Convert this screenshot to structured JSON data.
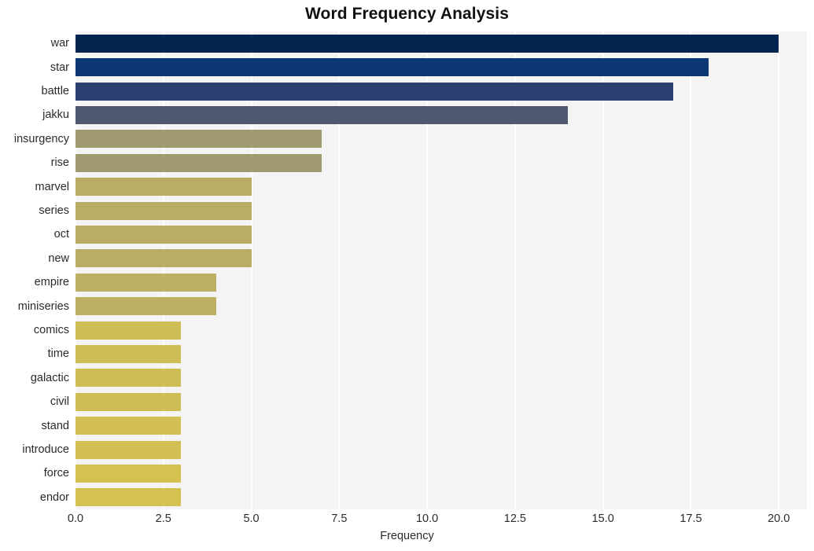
{
  "chart_data": {
    "type": "bar",
    "orientation": "horizontal",
    "title": "Word Frequency Analysis",
    "xlabel": "Frequency",
    "ylabel": "",
    "categories": [
      "war",
      "star",
      "battle",
      "jakku",
      "insurgency",
      "rise",
      "marvel",
      "series",
      "oct",
      "new",
      "empire",
      "miniseries",
      "comics",
      "time",
      "galactic",
      "civil",
      "stand",
      "introduce",
      "force",
      "endor"
    ],
    "values": [
      20,
      18,
      17,
      14,
      7,
      7,
      5,
      5,
      5,
      5,
      4,
      4,
      3,
      3,
      3,
      3,
      3,
      3,
      3,
      3
    ],
    "bar_colors": [
      "#03254f",
      "#0b3872",
      "#2a3f70",
      "#4f5871",
      "#a1996f",
      "#a1996f",
      "#b9ad66",
      "#b9ad66",
      "#b9ad66",
      "#b9ad66",
      "#bdb063",
      "#bdb063",
      "#cfbe55",
      "#cfbe55",
      "#cfbe55",
      "#cfbe55",
      "#d2c054",
      "#d2c054",
      "#d4c152",
      "#d4c152"
    ],
    "xlim": [
      0,
      20.8
    ],
    "xticks": [
      0,
      2.5,
      5,
      7.5,
      10,
      12.5,
      15,
      17.5,
      20
    ],
    "xticklabels": [
      "0.0",
      "2.5",
      "5.0",
      "7.5",
      "10.0",
      "12.5",
      "15.0",
      "17.5",
      "20.0"
    ],
    "grid": true,
    "grid_axis": "x",
    "grid_color": "#ffffff",
    "plot_background": "#f4f4f5",
    "figure_background": "#ffffff",
    "legend": null
  }
}
